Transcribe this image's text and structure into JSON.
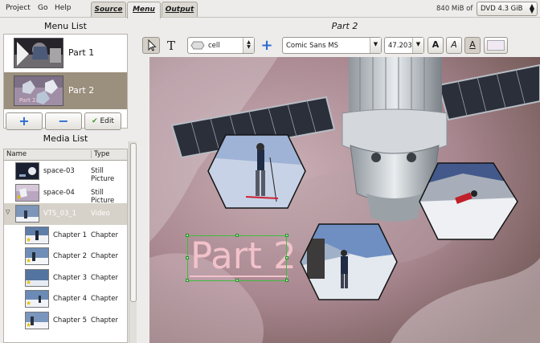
{
  "app": {
    "menus": [
      "Project",
      "Go",
      "Help"
    ],
    "tabs": [
      "Source",
      "Menu",
      "Output"
    ],
    "active_tab": "Menu",
    "size_text": "840 MiB of",
    "disc_select": "DVD 4.3 GiB"
  },
  "left": {
    "menu_list_title": "Menu List",
    "menus": [
      {
        "label": "Part 1",
        "selected": false
      },
      {
        "label": "Part 2",
        "selected": true
      }
    ],
    "buttons": {
      "add": "+",
      "remove": "−",
      "edit": "Edit"
    },
    "media_list_title": "Media List",
    "columns": [
      "Name",
      "Type"
    ],
    "media": [
      {
        "name": "space-03",
        "type": "Still Picture"
      },
      {
        "name": "space-04",
        "type": "Still Picture"
      },
      {
        "name": "VTS_03_1",
        "type": "Video"
      },
      {
        "name": "Chapter 1",
        "type": "Chapter"
      },
      {
        "name": "Chapter 2",
        "type": "Chapter"
      },
      {
        "name": "Chapter 3",
        "type": "Chapter"
      },
      {
        "name": "Chapter 4",
        "type": "Chapter"
      },
      {
        "name": "Chapter 5",
        "type": "Chapter"
      }
    ]
  },
  "editor": {
    "title": "Part 2",
    "shape_combo": "cell",
    "font_combo": "Comic Sans MS",
    "size_combo": "47.203",
    "bold_label": "A",
    "italic_label": "A",
    "underline_label": "A",
    "canvas_text": "Part 2",
    "colors": {
      "text": "#f2c2cb",
      "selection": "#3dbd3d",
      "swatch": "#f1e8f4"
    }
  }
}
